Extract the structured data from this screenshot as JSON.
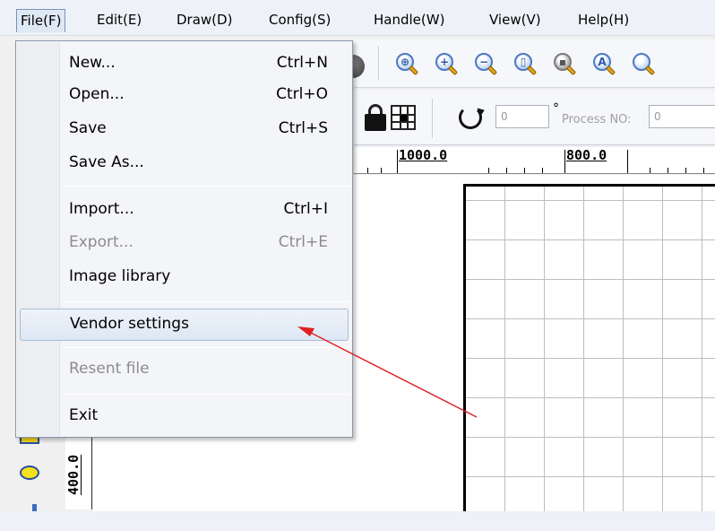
{
  "menubar": {
    "items": [
      {
        "label": "File(F)",
        "name": "menu-file"
      },
      {
        "label": "Edit(E)",
        "name": "menu-edit"
      },
      {
        "label": "Draw(D)",
        "name": "menu-draw"
      },
      {
        "label": "Config(S)",
        "name": "menu-config"
      },
      {
        "label": "Handle(W)",
        "name": "menu-handle"
      },
      {
        "label": "View(V)",
        "name": "menu-view"
      },
      {
        "label": "Help(H)",
        "name": "menu-help"
      }
    ]
  },
  "file_menu": {
    "items": [
      {
        "label": "New...",
        "shortcut": "Ctrl+N",
        "enabled": true
      },
      {
        "label": "Open...",
        "shortcut": "Ctrl+O",
        "enabled": true
      },
      {
        "label": "Save",
        "shortcut": "Ctrl+S",
        "enabled": true
      },
      {
        "label": "Save As...",
        "shortcut": "",
        "enabled": true
      },
      {
        "label": "Import...",
        "shortcut": "Ctrl+I",
        "enabled": true
      },
      {
        "label": "Export...",
        "shortcut": "Ctrl+E",
        "enabled": false
      },
      {
        "label": "Image library",
        "shortcut": "",
        "enabled": true
      },
      {
        "label": "Vendor settings",
        "shortcut": "",
        "enabled": true,
        "highlighted": true
      },
      {
        "label": "Resent file",
        "shortcut": "",
        "enabled": false
      },
      {
        "label": "Exit",
        "shortcut": "",
        "enabled": true
      }
    ]
  },
  "toolbar": {
    "zoom_icons": [
      "zoom-all-icon",
      "zoom-in-icon",
      "zoom-out-icon",
      "zoom-page-icon",
      "zoom-data-icon",
      "zoom-auto-icon",
      "zoom-icon"
    ],
    "rotation_value": "0",
    "degree_symbol": "°",
    "process_label": "Process NO:",
    "process_value": "0"
  },
  "ruler": {
    "top_labels": [
      "1000.0",
      "800.0"
    ],
    "left_label": "400.0"
  },
  "colors": {
    "annotation_arrow": "#e02020",
    "menu_highlight": "#dde7f4"
  }
}
